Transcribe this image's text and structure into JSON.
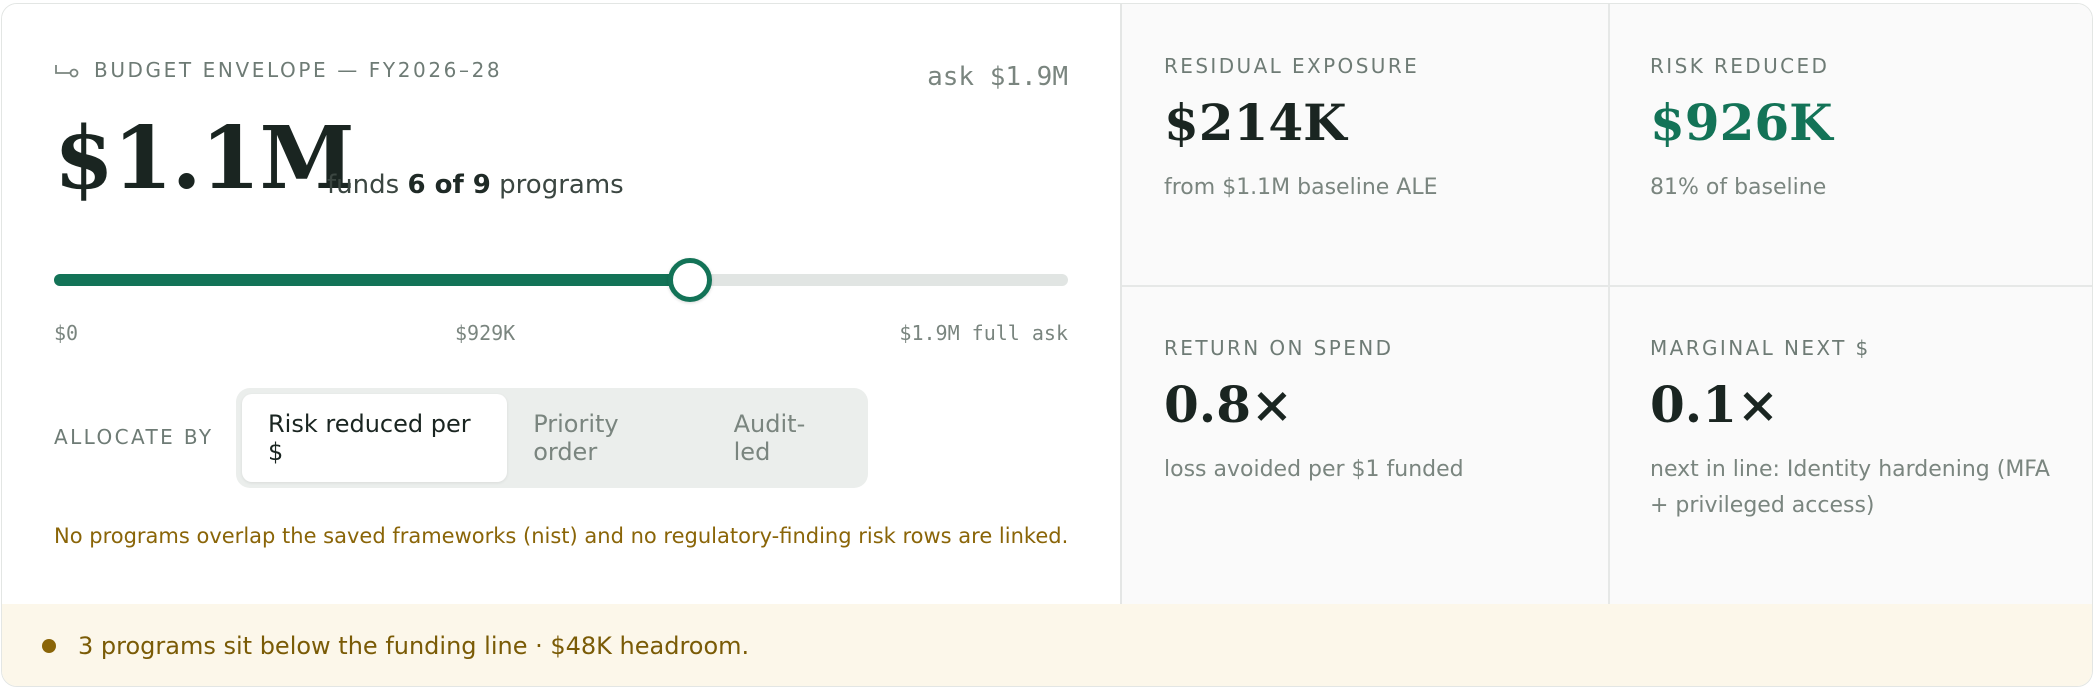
{
  "envelope": {
    "eyebrow": "BUDGET ENVELOPE — FY2026–28",
    "ask": "ask $1.9M",
    "amount": "$1.1M",
    "funds_prefix": "funds ",
    "funds_count": "6 of 9",
    "funds_suffix": " programs",
    "slider_fraction": 0.6263,
    "ticks": {
      "min": "$0",
      "mid": "$929K",
      "max": "$1.9M full ask"
    }
  },
  "allocate": {
    "label": "ALLOCATE BY",
    "options": [
      "Risk reduced per $",
      "Priority order",
      "Audit-led"
    ],
    "selected": "Risk reduced per $"
  },
  "note": "No programs overlap the saved frameworks (nist) and no regulatory-finding risk rows are linked.",
  "banner": "3 programs sit below the funding line · $48K headroom.",
  "kpis": {
    "residual": {
      "label": "RESIDUAL EXPOSURE",
      "value": "$214K",
      "sub": "from $1.1M baseline ALE"
    },
    "reduced": {
      "label": "RISK REDUCED",
      "value": "$926K",
      "sub": "81% of baseline"
    },
    "return": {
      "label": "RETURN ON SPEND",
      "value": "0.8×",
      "sub": "loss avoided per $1 funded"
    },
    "marginal": {
      "label": "MARGINAL NEXT $",
      "value": "0.1×",
      "sub": "next in line: Identity hardening (MFA + privileged access)"
    }
  },
  "colors": {
    "accent": "#137357",
    "warning": "#8a6508",
    "banner_bg": "#fcf7ea"
  },
  "icons": {
    "eyebrow": "envelope-icon",
    "banner": "status-dot-icon"
  }
}
